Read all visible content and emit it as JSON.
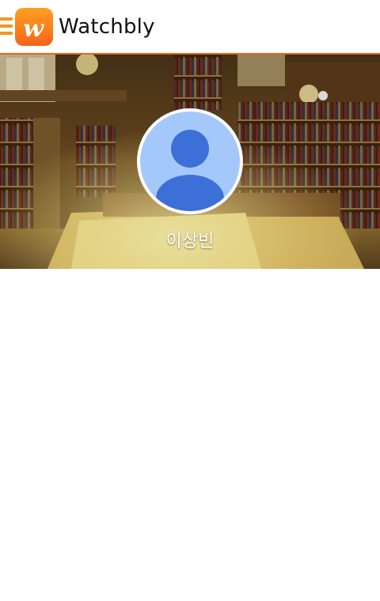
{
  "app": {
    "title": "Watchbly",
    "logo_letter": "w",
    "accent_color": "#f0621a"
  },
  "icons": {
    "menu": "hamburger-menu-icon",
    "avatar": "default-user-avatar-icon"
  },
  "profile": {
    "name": "이상빈",
    "cover": "library-interior-photo"
  }
}
